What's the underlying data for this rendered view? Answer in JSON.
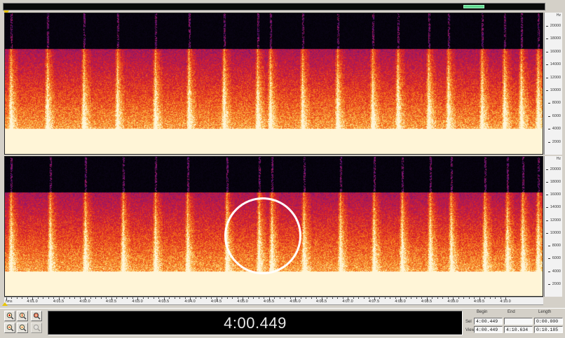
{
  "frequency_axis": {
    "unit_label": "Hz",
    "labels": [
      "20000",
      "18000",
      "16000",
      "14000",
      "12000",
      "10000",
      "8000",
      "6000",
      "4000",
      "2000"
    ]
  },
  "time_ruler": {
    "unit_label": "hms",
    "labels": [
      "4:01.0",
      "4:01.5",
      "4:02.0",
      "4:02.5",
      "4:03.0",
      "4:03.5",
      "4:04.0",
      "4:04.5",
      "4:05.0",
      "4:05.5",
      "4:06.0",
      "4:06.5",
      "4:07.0",
      "4:07.5",
      "4:08.0",
      "4:08.5",
      "4:09.0",
      "4:09.5",
      "4:10.0"
    ]
  },
  "time_display": {
    "value": "4:00.449"
  },
  "selection_panel": {
    "headers": {
      "begin": "Begin",
      "end": "End",
      "length": "Length"
    },
    "sel": {
      "label": "Sel",
      "begin": "4:00.449",
      "end": "",
      "length": "0:00.000"
    },
    "view": {
      "label": "View",
      "begin": "4:00.449",
      "end": "4:10.634",
      "length": "0:10.185"
    }
  },
  "zoom_buttons": [
    {
      "icon": "zoom-in-icon"
    },
    {
      "icon": "zoom-in-vertical-icon"
    },
    {
      "icon": "zoom-full-icon"
    },
    {
      "icon": "zoom-out-icon"
    },
    {
      "icon": "zoom-out-vertical-icon"
    },
    {
      "icon": "zoom-selection-icon"
    }
  ],
  "colors": {
    "scrollbar_thumb": "#5fd88f",
    "playhead": "#e8c400",
    "spectrogram_background": "#000000",
    "annotation_circle": "#ffffff"
  }
}
